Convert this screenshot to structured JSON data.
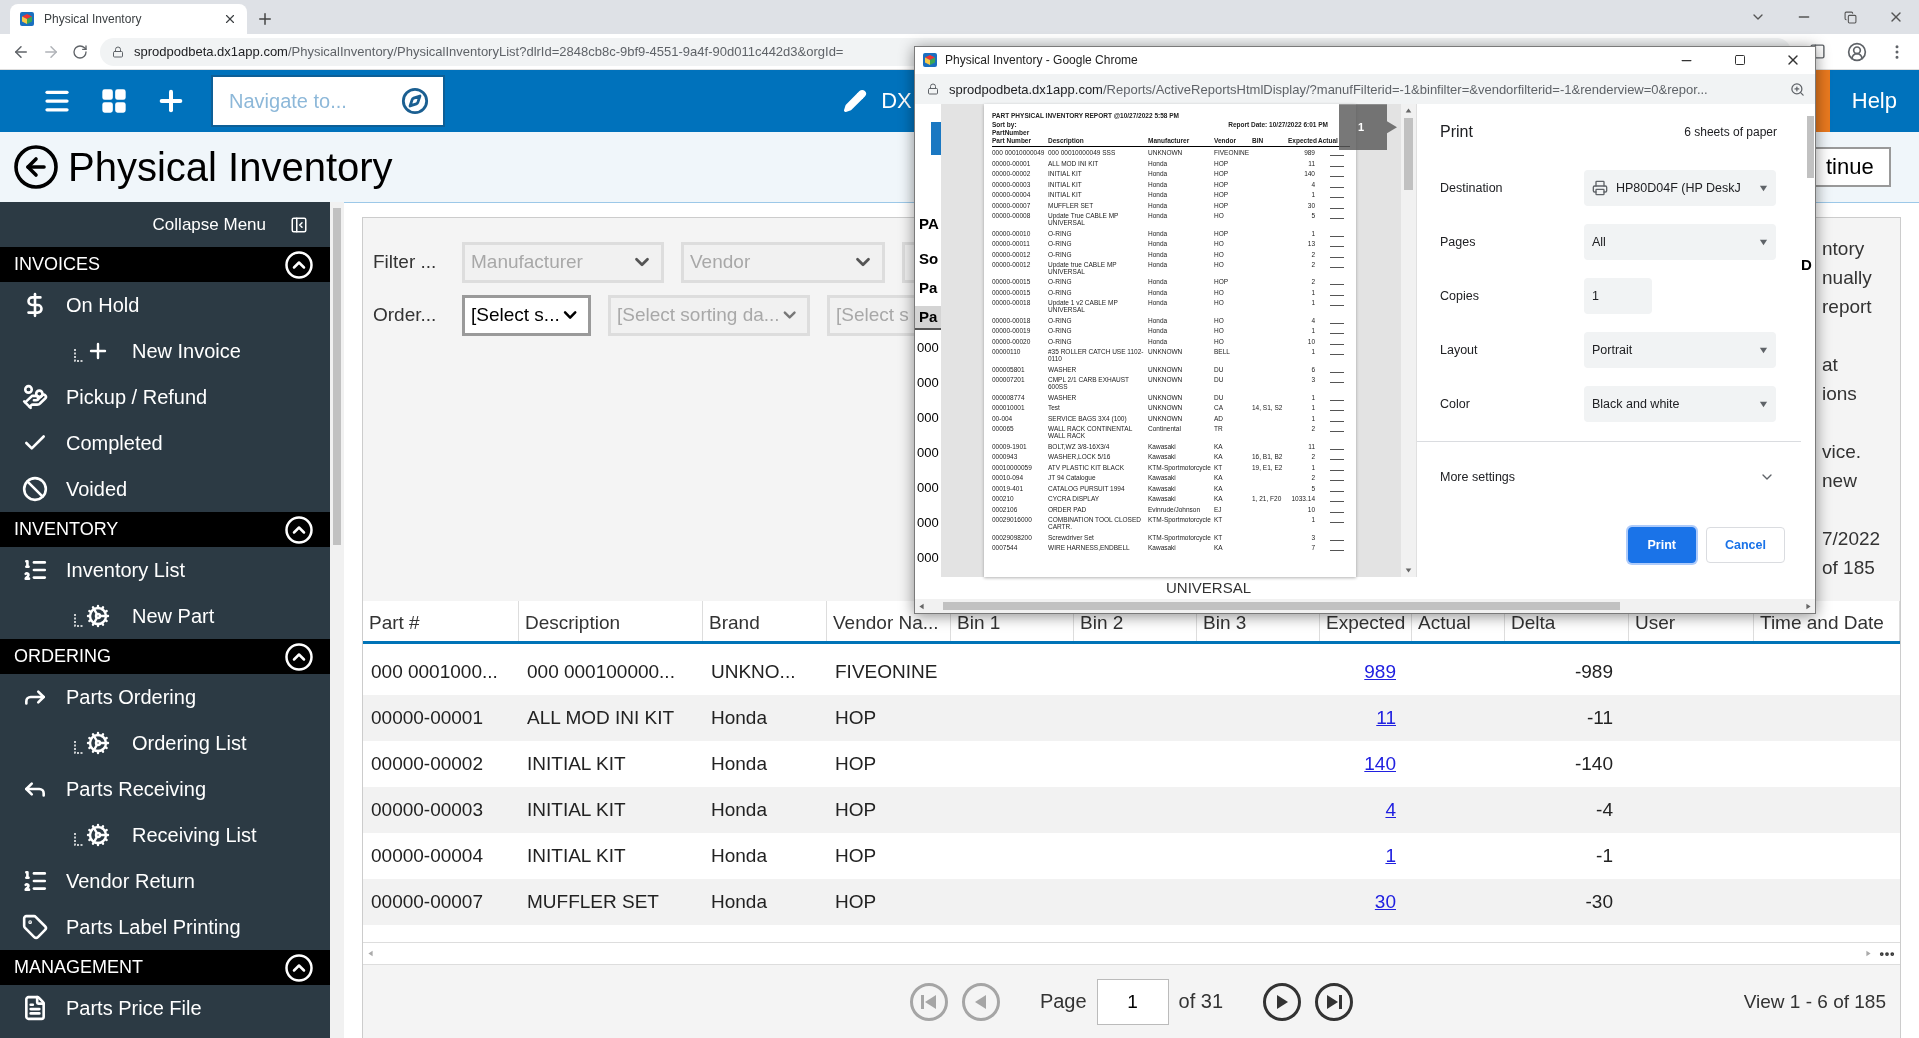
{
  "browser": {
    "tab_title": "Physical Inventory",
    "url_host": "sprodpodbeta.dx1app.com",
    "url_path": "/PhysicalInventory/PhysicalInventoryList?dlrId=2848cb8c-9bf9-4551-9a4f-90d011c442d3&orgId="
  },
  "header": {
    "search_placeholder": "Navigate to...",
    "user_partial": "DX",
    "help": "Help"
  },
  "page": {
    "title": "Physical Inventory",
    "button_partial": "tinue"
  },
  "sidebar": {
    "collapse_label": "Collapse Menu",
    "sections": [
      {
        "title": "INVOICES",
        "expanded": true,
        "items": [
          {
            "label": "On Hold",
            "kind": "main"
          },
          {
            "label": "New Invoice",
            "kind": "sub"
          },
          {
            "label": "Pickup / Refund",
            "kind": "main"
          },
          {
            "label": "Completed",
            "kind": "main"
          },
          {
            "label": "Voided",
            "kind": "main"
          }
        ]
      },
      {
        "title": "INVENTORY",
        "expanded": true,
        "items": [
          {
            "label": "Inventory List",
            "kind": "main"
          },
          {
            "label": "New Part",
            "kind": "sub"
          }
        ]
      },
      {
        "title": "ORDERING",
        "expanded": true,
        "items": [
          {
            "label": "Parts Ordering",
            "kind": "main"
          },
          {
            "label": "Ordering List",
            "kind": "sub"
          },
          {
            "label": "Parts Receiving",
            "kind": "main"
          },
          {
            "label": "Receiving List",
            "kind": "sub"
          },
          {
            "label": "Vendor Return",
            "kind": "main"
          },
          {
            "label": "Parts Label Printing",
            "kind": "main"
          }
        ]
      },
      {
        "title": "MANAGEMENT",
        "expanded": true,
        "items": [
          {
            "label": "Parts Price File",
            "kind": "main"
          }
        ]
      }
    ]
  },
  "filters": {
    "filter_label": "Filter ...",
    "filter_selects": [
      {
        "placeholder": "Manufacturer",
        "disabled": true
      },
      {
        "placeholder": "Vendor",
        "disabled": true
      },
      {
        "disabled": true
      }
    ],
    "order_label": "Order...",
    "order_selects": [
      {
        "placeholder": "[Select s...",
        "disabled": false
      },
      {
        "placeholder": "[Select sorting da...",
        "disabled": true
      },
      {
        "placeholder": "[Select s",
        "disabled": true
      }
    ]
  },
  "info_fragments": [
    [
      "ntory",
      "nually",
      "report"
    ],
    [
      "at",
      "ions"
    ],
    [
      "vice.",
      "new"
    ],
    [
      "7/2022",
      "of 185"
    ]
  ],
  "table": {
    "columns": [
      "Part #",
      "Description",
      "Brand",
      "Vendor Na...",
      "Bin 1",
      "Bin 2",
      "Bin 3",
      "Expected",
      "Actual",
      "Delta",
      "User",
      "Time and Date"
    ],
    "rows": [
      {
        "part": "000 0001000...",
        "description": "000 000100000...",
        "brand": "UNKNO...",
        "vendor": "FIVEONINE",
        "expected": "989",
        "delta": "-989"
      },
      {
        "part": "00000-00001",
        "description": "ALL MOD INI KIT",
        "brand": "Honda",
        "vendor": "HOP",
        "expected": "11",
        "delta": "-11"
      },
      {
        "part": "00000-00002",
        "description": "INITIAL KIT",
        "brand": "Honda",
        "vendor": "HOP",
        "expected": "140",
        "delta": "-140"
      },
      {
        "part": "00000-00003",
        "description": "INITIAL KIT",
        "brand": "Honda",
        "vendor": "HOP",
        "expected": "4",
        "delta": "-4"
      },
      {
        "part": "00000-00004",
        "description": "INITIAL KIT",
        "brand": "Honda",
        "vendor": "HOP",
        "expected": "1",
        "delta": "-1"
      },
      {
        "part": "00000-00007",
        "description": "MUFFLER SET",
        "brand": "Honda",
        "vendor": "HOP",
        "expected": "30",
        "delta": "-30"
      }
    ]
  },
  "pager": {
    "buttons": [
      {
        "kind": "first",
        "disabled": true
      },
      {
        "kind": "previous",
        "disabled": true
      },
      {
        "kind": "next",
        "disabled": false
      },
      {
        "kind": "last",
        "disabled": false
      }
    ],
    "page_label": "Page",
    "page_value": "1",
    "of_pages": "of 31",
    "view_info": "View 1 - 6 of 185"
  },
  "popup": {
    "title": "Physical Inventory - Google Chrome",
    "url_host": "sprodpodbeta.dx1app.com",
    "url_path": "/Reports/ActiveReportsHtmlDisplay/?manufFilterid=-1&binfilter=&vendorfilterid=-1&renderview=0&repor...",
    "page_fragments": {
      "left": [
        "PA",
        "So",
        "Pa"
      ],
      "header": "Pa",
      "rows": [
        "000",
        "000",
        "000",
        "000",
        "000",
        "000",
        "000"
      ],
      "right": "D",
      "bottom": "UNIVERSAL"
    },
    "page_number": "1",
    "report": {
      "title": "PART PHYSICAL INVENTORY REPORT @10/27/2022 5:58 PM",
      "sort_label": "Sort by:",
      "sort_value": "PartNumber",
      "report_date": "Report Date: 10/27/2022 6:01 PM",
      "columns": [
        "Part Number",
        "Description",
        "Manufacturer",
        "Vendor",
        "BIN",
        "Expected",
        "Actual"
      ],
      "rows": [
        {
          "part": "000 00010000049",
          "description": "000 00010000049 SSS",
          "manufacturer": "UNKNOWN",
          "vendor": "FIVEONINE",
          "expected": "989"
        },
        {
          "part": "00000-00001",
          "description": "ALL MOD INI KIT",
          "manufacturer": "Honda",
          "vendor": "HOP",
          "expected": "11"
        },
        {
          "part": "00000-00002",
          "description": "INITIAL KIT",
          "manufacturer": "Honda",
          "vendor": "HOP",
          "expected": "140"
        },
        {
          "part": "00000-00003",
          "description": "INITIAL KIT",
          "manufacturer": "Honda",
          "vendor": "HOP",
          "expected": "4"
        },
        {
          "part": "00000-00004",
          "description": "INITIAL KIT",
          "manufacturer": "Honda",
          "vendor": "HOP",
          "expected": "1"
        },
        {
          "part": "00000-00007",
          "description": "MUFFLER SET",
          "manufacturer": "Honda",
          "vendor": "HOP",
          "expected": "30"
        },
        {
          "part": "00000-00008",
          "description": "Update True CABLE MP UNIVERSAL",
          "manufacturer": "Honda",
          "vendor": "HO",
          "expected": "5"
        },
        {
          "part": "00000-00010",
          "description": "O-RING",
          "manufacturer": "Honda",
          "vendor": "HOP",
          "expected": "1"
        },
        {
          "part": "00000-00011",
          "description": "O-RING",
          "manufacturer": "Honda",
          "vendor": "HO",
          "expected": "13"
        },
        {
          "part": "00000-00012",
          "description": "O-RING",
          "manufacturer": "Honda",
          "vendor": "HO",
          "expected": "2"
        },
        {
          "part": "00000-00012",
          "description": "Update true CABLE MP UNIVERSAL",
          "manufacturer": "Honda",
          "vendor": "HO",
          "expected": "2"
        },
        {
          "part": "00000-00015",
          "description": "O-RING",
          "manufacturer": "Honda",
          "vendor": "HOP",
          "expected": "2"
        },
        {
          "part": "00000-00015",
          "description": "O-RING",
          "manufacturer": "Honda",
          "vendor": "HO",
          "expected": "1"
        },
        {
          "part": "00000-00018",
          "description": "Update 1 v2 CABLE MP UNIVERSAL",
          "manufacturer": "Honda",
          "vendor": "HO",
          "expected": "1"
        },
        {
          "part": "00000-00018",
          "description": "O-RING",
          "manufacturer": "Honda",
          "vendor": "HO",
          "expected": "4"
        },
        {
          "part": "00000-00019",
          "description": "O-RING",
          "manufacturer": "Honda",
          "vendor": "HO",
          "expected": "1"
        },
        {
          "part": "00000-00020",
          "description": "O-RING",
          "manufacturer": "Honda",
          "vendor": "HO",
          "expected": "10"
        },
        {
          "part": "00000110",
          "description": "#35 ROLLER CATCH USE 1102-0110",
          "manufacturer": "UNKNOWN",
          "vendor": "BELL",
          "expected": "1"
        },
        {
          "part": "000005801",
          "description": "WASHER",
          "manufacturer": "UNKNOWN",
          "vendor": "DU",
          "expected": "6"
        },
        {
          "part": "000007201",
          "description": "CMPL 2/1 CARB EXHAUST 600SS",
          "manufacturer": "UNKNOWN",
          "vendor": "DU",
          "expected": "3"
        },
        {
          "part": "000008774",
          "description": "WASHER",
          "manufacturer": "UNKNOWN",
          "vendor": "DU",
          "expected": "1"
        },
        {
          "part": "000010001",
          "description": "Test",
          "manufacturer": "UNKNOWN",
          "vendor": "CA",
          "bin": "14, S1, S2",
          "expected": "1"
        },
        {
          "part": "00-004",
          "description": "SERVICE BAGS 3X4 (100)",
          "manufacturer": "UNKNOWN",
          "vendor": "AD",
          "expected": "1"
        },
        {
          "part": "000065",
          "description": "WALL RACK CONTINENTAL WALL RACK",
          "manufacturer": "Continental",
          "vendor": "TR",
          "expected": "2"
        },
        {
          "part": "00009-1901",
          "description": "BOLT,WZ 3/8-16X3/4",
          "manufacturer": "Kawasaki",
          "vendor": "KA",
          "expected": "11"
        },
        {
          "part": "0000943",
          "description": "WASHER,LOCK 5/16",
          "manufacturer": "Kawasaki",
          "vendor": "KA",
          "bin": "16, B1, B2",
          "expected": "2"
        },
        {
          "part": "00010000059",
          "description": "ATV PLASTIC KIT BLACK",
          "manufacturer": "KTM-Sportmotorcycle",
          "vendor": "KT",
          "bin": "19, E1, E2",
          "expected": "1"
        },
        {
          "part": "00010-094",
          "description": "JT 94 Catalogue",
          "manufacturer": "Kawasaki",
          "vendor": "KA",
          "expected": "2"
        },
        {
          "part": "00019-401",
          "description": "CATALOG PURSUIT 1994",
          "manufacturer": "Kawasaki",
          "vendor": "KA",
          "expected": "5"
        },
        {
          "part": "000210",
          "description": "CYCRA DISPLAY",
          "manufacturer": "Kawasaki",
          "vendor": "KA",
          "bin": "1, 21, F20",
          "expected": "1033.14"
        },
        {
          "part": "0002106",
          "description": "ORDER PAD",
          "manufacturer": "Evinrude/Johnson",
          "vendor": "EJ",
          "expected": "10"
        },
        {
          "part": "00029016000",
          "description": "COMBINATION TOOL CLOSED CARTR.",
          "manufacturer": "KTM-Sportmotorcycle",
          "vendor": "KT",
          "expected": "1"
        },
        {
          "part": "00029098200",
          "description": "Screwdriver Set",
          "manufacturer": "KTM-Sportmotorcycle",
          "vendor": "KT",
          "expected": "3"
        },
        {
          "part": "0007544",
          "description": "WIRE HARNESS,ENDBELL",
          "manufacturer": "Kawasaki",
          "vendor": "KA",
          "expected": "7"
        }
      ]
    },
    "print": {
      "title": "Print",
      "sheets": "6 sheets of paper",
      "fields": [
        {
          "label": "Destination",
          "value": "HP80D04F (HP DeskJ",
          "kind": "printer"
        },
        {
          "label": "Pages",
          "value": "All",
          "kind": "select"
        },
        {
          "label": "Copies",
          "value": "1",
          "kind": "input"
        },
        {
          "label": "Layout",
          "value": "Portrait",
          "kind": "select"
        },
        {
          "label": "Color",
          "value": "Black and white",
          "kind": "select"
        }
      ],
      "more": "More settings",
      "buttons": [
        {
          "label": "Print",
          "kind": "primary"
        },
        {
          "label": "Cancel",
          "kind": "secondary"
        }
      ]
    }
  }
}
